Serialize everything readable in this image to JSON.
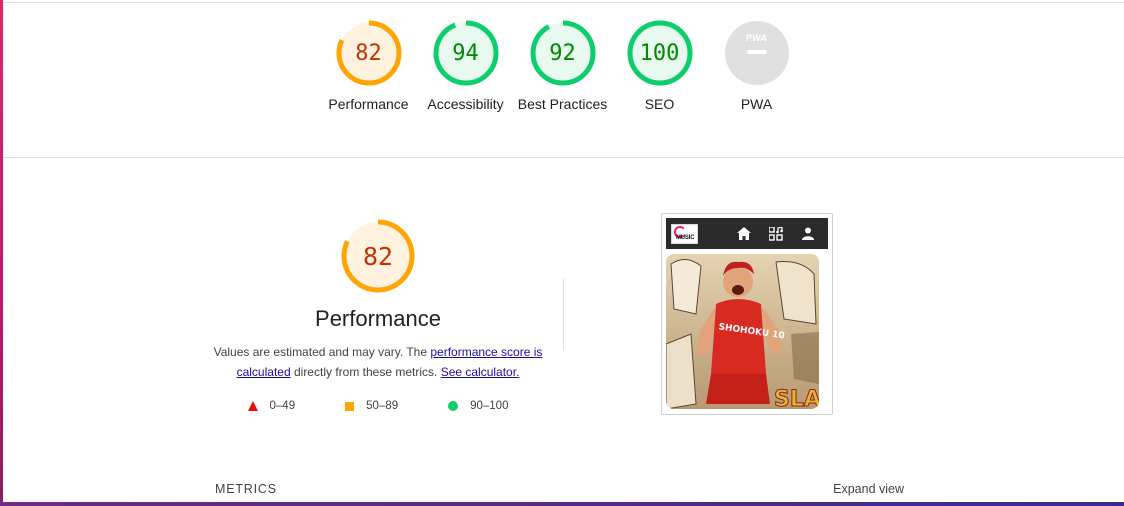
{
  "colors": {
    "fail": "#eb0f00",
    "average": "#ffa400",
    "pass": "#0cce6b",
    "average_text": "#c33300",
    "pass_text": "#008800",
    "na": "#e0e0e0"
  },
  "summary": {
    "gauges": [
      {
        "score": "82",
        "label": "Performance",
        "rating": "average",
        "fraction": 0.82
      },
      {
        "score": "94",
        "label": "Accessibility",
        "rating": "pass",
        "fraction": 0.94
      },
      {
        "score": "92",
        "label": "Best Practices",
        "rating": "pass",
        "fraction": 0.92
      },
      {
        "score": "100",
        "label": "SEO",
        "rating": "pass",
        "fraction": 1.0
      }
    ],
    "pwa": {
      "label": "PWA",
      "badge_text": "PWA"
    }
  },
  "performance": {
    "score": "82",
    "fraction": 0.82,
    "title": "Performance",
    "desc_prefix": "Values are estimated and may vary. The ",
    "link_score": "performance score is calculated",
    "desc_middle": " directly from these metrics. ",
    "link_calculator": "See calculator.",
    "legend": [
      {
        "range": "0–49",
        "icon": "triangle-icon"
      },
      {
        "range": "50–89",
        "icon": "square-icon"
      },
      {
        "range": "90–100",
        "icon": "circle-icon"
      }
    ]
  },
  "screenshot": {
    "logo_text": "MUSIC",
    "nav_icons": [
      "home-icon",
      "music-grid-icon",
      "user-icon"
    ],
    "hero_text": "SHOHOKU 10",
    "hero_corner_text": "SLA"
  },
  "metrics": {
    "label": "METRICS",
    "expand_label": "Expand view"
  }
}
